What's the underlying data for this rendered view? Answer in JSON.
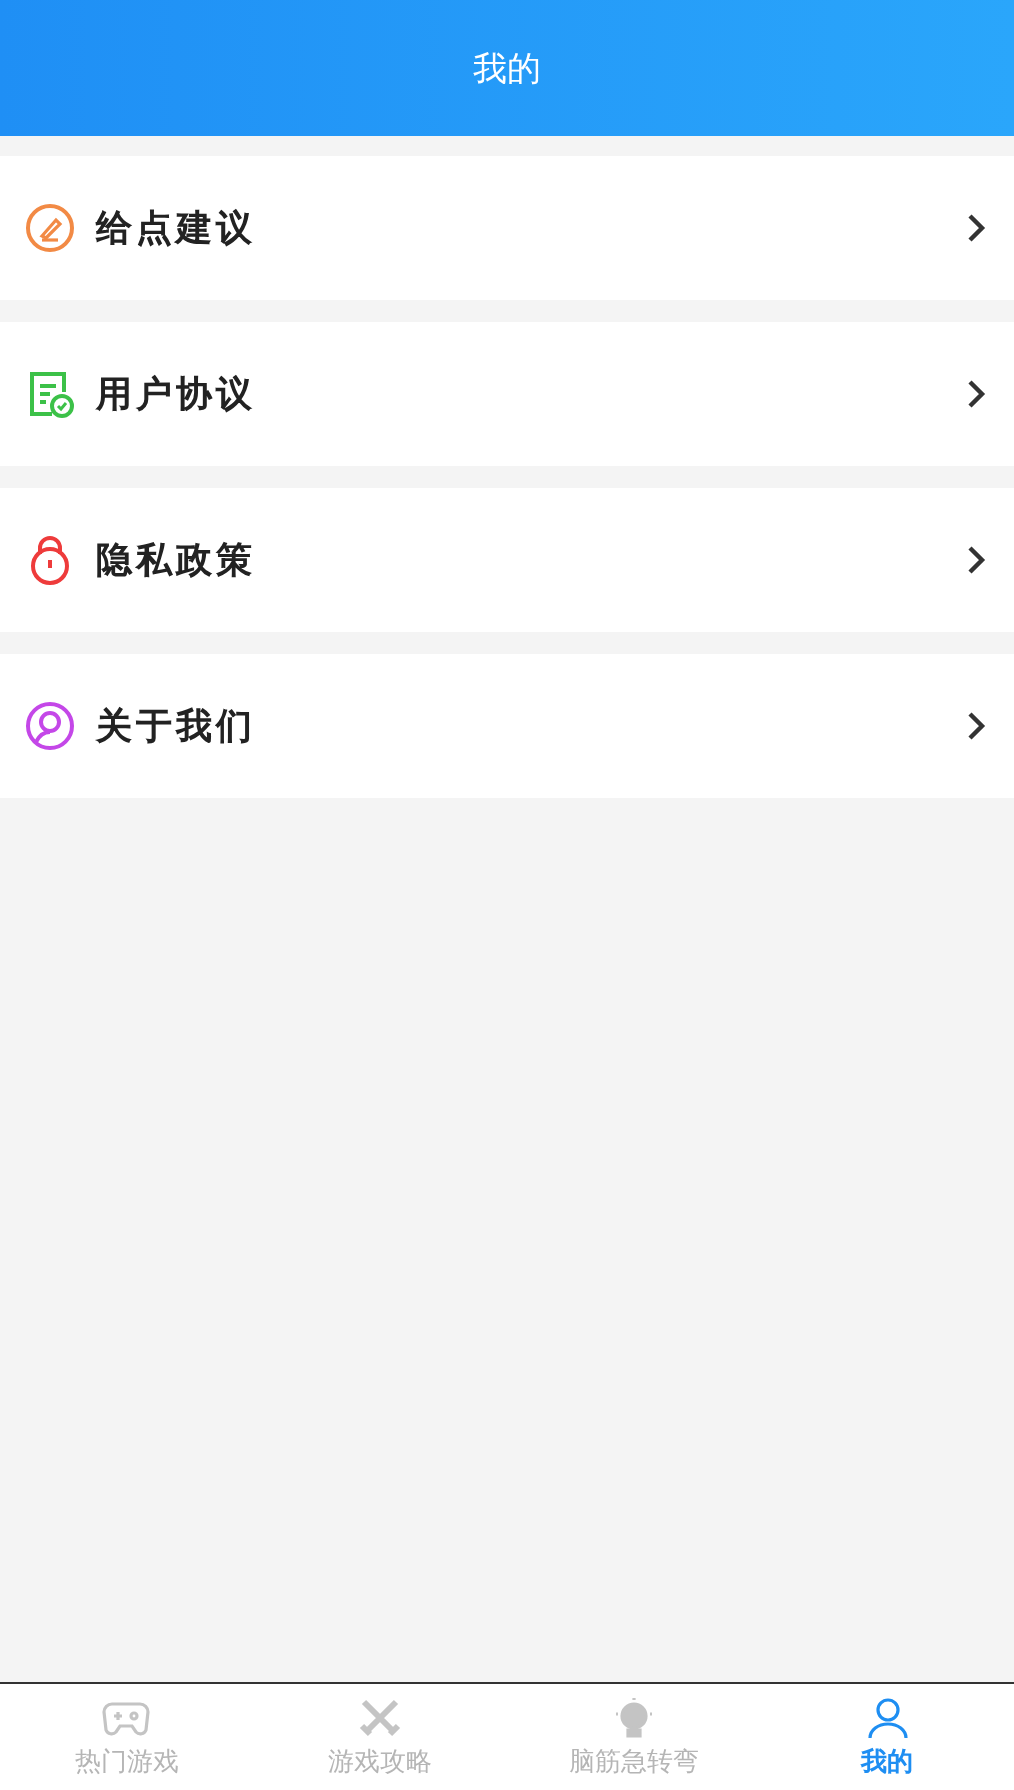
{
  "header": {
    "title": "我的"
  },
  "menu": [
    {
      "label": "给点建议",
      "kind": "feedback"
    },
    {
      "label": "用户协议",
      "kind": "agreement"
    },
    {
      "label": "隐私政策",
      "kind": "privacy"
    },
    {
      "label": "关于我们",
      "kind": "about"
    }
  ],
  "tab_bar": [
    {
      "label": "热门游戏",
      "kind": "gamepad",
      "selected": false
    },
    {
      "label": "游戏攻略",
      "kind": "swords",
      "selected": false
    },
    {
      "label": "脑筋急转弯",
      "kind": "bulb",
      "selected": false
    },
    {
      "label": "我的",
      "kind": "person",
      "selected": true
    }
  ]
}
